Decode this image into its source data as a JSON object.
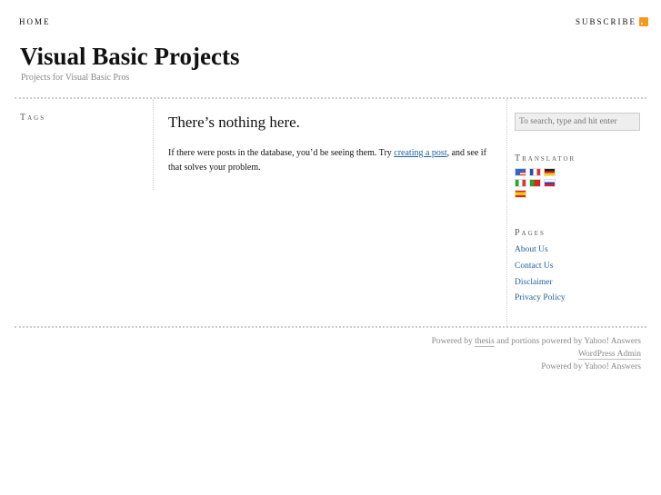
{
  "nav": {
    "home": "HOME",
    "subscribe": "SUBSCRIBE"
  },
  "header": {
    "title": "Visual Basic Projects",
    "tagline": "Projects for Visual Basic Pros"
  },
  "left": {
    "tags_heading": "Tags"
  },
  "main": {
    "heading": "There’s nothing here.",
    "text_before": "If there were posts in the database, you’d be seeing them. Try ",
    "link": "creating a post",
    "text_after": ", and see if that solves your problem."
  },
  "sidebar": {
    "search_placeholder": "To search, type and hit enter",
    "translator_heading": "Translator",
    "flags": [
      "english",
      "french",
      "german",
      "italian",
      "portuguese",
      "russian",
      "spanish"
    ],
    "pages_heading": "Pages",
    "pages": [
      "About Us",
      "Contact Us",
      "Disclaimer",
      "Privacy Policy"
    ]
  },
  "footer": {
    "powered_by": "Powered by ",
    "thesis": "thesis",
    "portions": " and portions powered by Yahoo! Answers",
    "admin": "WordPress Admin",
    "yahoo": "Powered by Yahoo! Answers"
  }
}
